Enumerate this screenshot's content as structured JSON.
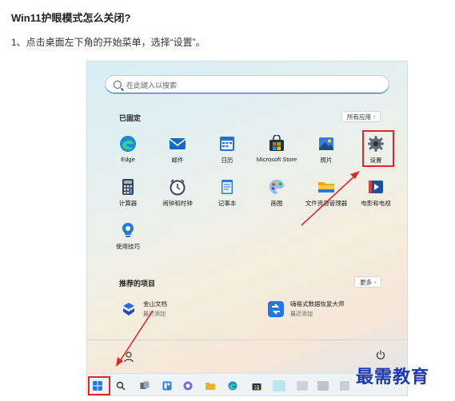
{
  "article": {
    "title": "Win11护眼模式怎么关闭?",
    "step1": "1、点击桌面左下角的开始菜单，选择“设置”。"
  },
  "start_menu": {
    "search_placeholder": "在此键入以搜索",
    "pinned_title": "已固定",
    "all_apps_label": "所有应用",
    "pinned_apps": [
      {
        "label": "Edge",
        "icon": "edge-icon"
      },
      {
        "label": "邮件",
        "icon": "mail-icon"
      },
      {
        "label": "日历",
        "icon": "calendar-icon"
      },
      {
        "label": "Microsoft Store",
        "icon": "store-icon"
      },
      {
        "label": "照片",
        "icon": "photos-icon"
      },
      {
        "label": "设置",
        "icon": "settings-gear-icon"
      },
      {
        "label": "计算器",
        "icon": "calculator-icon"
      },
      {
        "label": "闹钟和时钟",
        "icon": "alarm-clock-icon"
      },
      {
        "label": "记事本",
        "icon": "notepad-icon"
      },
      {
        "label": "画图",
        "icon": "paint-icon"
      },
      {
        "label": "文件资源管理器",
        "icon": "folder-icon"
      },
      {
        "label": "电影和电视",
        "icon": "movies-icon"
      },
      {
        "label": "使用技巧",
        "icon": "tips-icon"
      }
    ],
    "recommended_title": "推荐的项目",
    "more_label": "更多",
    "recommended": [
      {
        "name": "金山文档",
        "sub": "最近添加",
        "icon": "kdocs-icon"
      },
      {
        "name": "嗨格式数据恢复大师",
        "sub": "最近添加",
        "icon": "recovery-icon"
      }
    ]
  },
  "colors": {
    "highlight": "#e0262b",
    "accent": "#2b6fd0",
    "watermark": "#1d3aa8"
  },
  "watermark": "最需教育"
}
